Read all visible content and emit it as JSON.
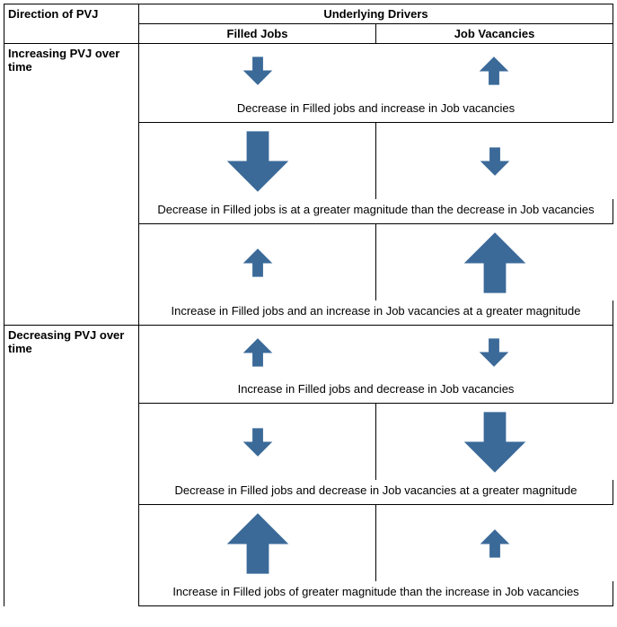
{
  "headers": {
    "direction": "Direction of PVJ",
    "underlying": "Underlying Drivers",
    "filled": "Filled Jobs",
    "vacancies": "Job Vacancies"
  },
  "directions": {
    "increasing": "Increasing PVJ over time",
    "decreasing": "Decreasing PVJ over time"
  },
  "scenarios": [
    {
      "group": "increasing",
      "filled": {
        "dir": "down",
        "size": "small"
      },
      "vacancies": {
        "dir": "up",
        "size": "small"
      },
      "caption": "Decrease in Filled jobs and increase in Job vacancies"
    },
    {
      "group": "increasing",
      "filled": {
        "dir": "down",
        "size": "large"
      },
      "vacancies": {
        "dir": "down",
        "size": "small"
      },
      "caption": "Decrease in Filled jobs is at a greater magnitude than the decrease in Job vacancies"
    },
    {
      "group": "increasing",
      "filled": {
        "dir": "up",
        "size": "small"
      },
      "vacancies": {
        "dir": "up",
        "size": "large"
      },
      "caption": "Increase in Filled jobs and an increase in Job vacancies at a greater magnitude"
    },
    {
      "group": "decreasing",
      "filled": {
        "dir": "up",
        "size": "small"
      },
      "vacancies": {
        "dir": "down",
        "size": "small"
      },
      "caption": "Increase in Filled jobs and decrease in Job vacancies"
    },
    {
      "group": "decreasing",
      "filled": {
        "dir": "down",
        "size": "small"
      },
      "vacancies": {
        "dir": "down",
        "size": "large"
      },
      "caption": "Decrease in Filled jobs and decrease in Job vacancies at a greater magnitude"
    },
    {
      "group": "decreasing",
      "filled": {
        "dir": "up",
        "size": "large"
      },
      "vacancies": {
        "dir": "up",
        "size": "small"
      },
      "caption": "Increase in Filled jobs of greater magnitude than the increase in Job vacancies"
    }
  ],
  "arrow_color": "#3b6a99"
}
